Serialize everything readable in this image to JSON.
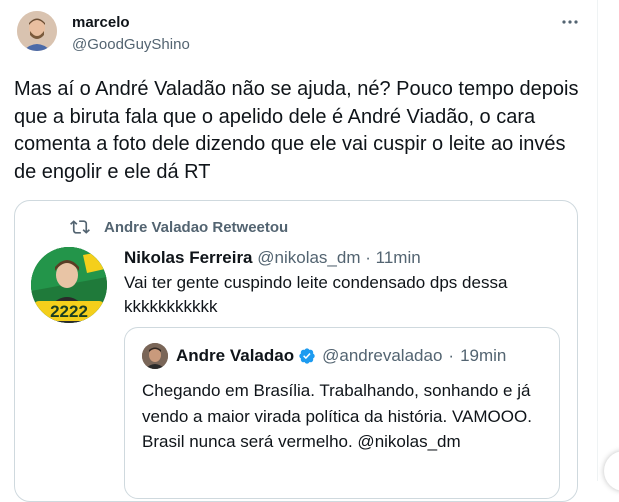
{
  "tweet": {
    "author_name": "marcelo",
    "author_handle": "@GoodGuyShino",
    "text": "Mas aí o André Valadão não se ajuda, né? Pouco tempo depois que a biruta fala que o apelido dele é André Viadão, o cara comenta a foto dele dizendo que ele vai cuspir o leite ao invés de engolir e ele dá RT",
    "more_icon": "more-dots-icon"
  },
  "embedded": {
    "retweet_label": "Andre Valadao Retweetou",
    "retweet_icon": "retweet-icon",
    "author_name": "Nikolas Ferreira",
    "author_handle": "@nikolas_dm",
    "time": "11min",
    "separator": "·",
    "text": "Vai ter gente cuspindo leite condensado dps dessa kkkkkkkkkkk",
    "avatar_badge": "2222",
    "quoted": {
      "author_name": "Andre Valadao",
      "author_handle": "@andrevaladao",
      "time": "19min",
      "separator": "·",
      "verified_icon": "verified-badge-icon",
      "text": "Chegando em Brasília. Trabalhando, sonhando e já vendo a maior virada política da história. VAMOOO. Brasil nunca será vermelho. @nikolas_dm"
    }
  },
  "colors": {
    "text": "#0f1419",
    "secondary": "#536471",
    "border": "#cfd9de",
    "verified": "#1d9bf0",
    "avatar_green": "#1c6b35",
    "badge_yellow": "#f4cf1b"
  }
}
